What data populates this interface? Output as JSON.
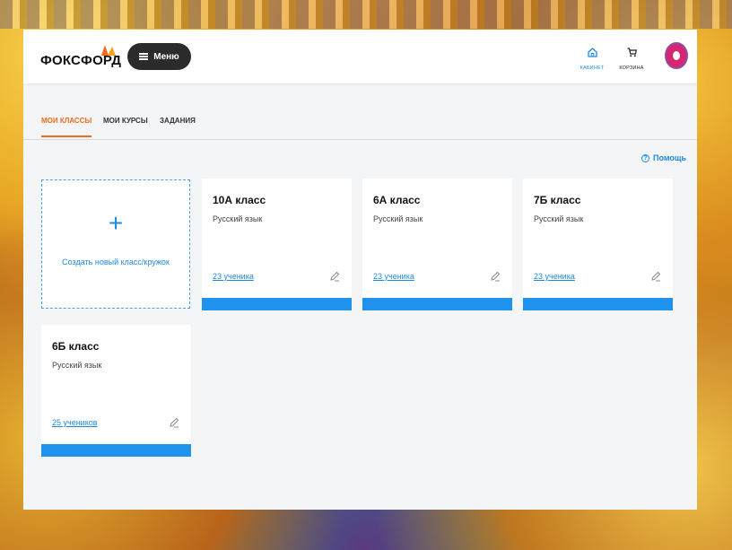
{
  "header": {
    "logo_text": "ФОКСФОРД",
    "menu_label": "Меню",
    "nav": [
      {
        "label": "КАБИНЕТ",
        "icon": "home-icon"
      },
      {
        "label": "КОРЗИНА",
        "icon": "cart-icon"
      }
    ],
    "avatar_icon": "owl-avatar-icon"
  },
  "tabs": [
    {
      "label": "МОИ КЛАССЫ",
      "active": true
    },
    {
      "label": "МОИ КУРСЫ",
      "active": false
    },
    {
      "label": "ЗАДАНИЯ",
      "active": false
    }
  ],
  "help_label": "Помощь",
  "create_card": {
    "plus": "+",
    "label": "Создать новый класс/кружок"
  },
  "classes": [
    {
      "title": "10А класс",
      "subject": "Русский язык",
      "students": "23 ученика"
    },
    {
      "title": "6А класс",
      "subject": "Русский язык",
      "students": "23 ученика"
    },
    {
      "title": "7Б класс",
      "subject": "Русский язык",
      "students": "23 ученика"
    },
    {
      "title": "6Б класс",
      "subject": "Русский язык",
      "students": "25 учеников"
    }
  ],
  "colors": {
    "accent": "#f26b1d",
    "link": "#1e88e5",
    "card_bar": "#1e92ec",
    "menu_button": "#2b2b2b"
  }
}
